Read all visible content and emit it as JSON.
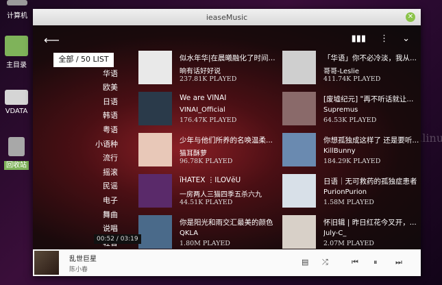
{
  "desktop": {
    "icons": [
      {
        "label": "计算机",
        "color": "#b0b0b0"
      },
      {
        "label": "主目录",
        "color": "#7fb35a"
      },
      {
        "label": "VDATA",
        "color": "#cfcfcf"
      },
      {
        "label": "回收站",
        "color": "#a0a0a0"
      }
    ]
  },
  "window": {
    "title": "ieaseMusic"
  },
  "categories": {
    "active": "全部 / 50 LIST",
    "items": [
      "华语",
      "欧美",
      "日语",
      "韩语",
      "粤语",
      "小语种",
      "流行",
      "摇滚",
      "民谣",
      "电子",
      "舞曲",
      "说唱",
      "轻音"
    ]
  },
  "playlists": [
    {
      "title": "似水年华|在晨曦融化了时间...",
      "creator": "晌有话好好说",
      "played": "237.81K PLAYED",
      "color": "#e9e9e9"
    },
    {
      "title": "「华语」你不必冷淡，我从...",
      "creator": "哥哥-Leslie",
      "played": "411.74K PLAYED",
      "color": "#cfcfcf"
    },
    {
      "title": "We are VINAI",
      "creator": "VINAI_Official",
      "played": "176.47K PLAYED",
      "color": "#2a3a4a"
    },
    {
      "title": "[废墟纪元] \"再不听话就让...",
      "creator": "Supremus",
      "played": "64.53K PLAYED",
      "color": "#8a6a6a"
    },
    {
      "title": "少年与他们所养的名唤温柔...",
      "creator": "猫耳酥萝",
      "played": "96.78K PLAYED",
      "color": "#e8c8b8"
    },
    {
      "title": "你想孤独成这样了 还是要听...",
      "creator": "KillBunny",
      "played": "184.29K PLAYED",
      "color": "#6a8ab0"
    },
    {
      "title": "ĭHATEⅩ ⋮ILOVĕU",
      "creator": "一房两人三猫四季五杀六九",
      "played": "44.51K PLAYED",
      "color": "#5a2a6a"
    },
    {
      "title": "日语｜无可救药的孤独症患者",
      "creator": "PurionPurion",
      "played": "1.58M PLAYED",
      "color": "#d8e0e8"
    },
    {
      "title": "你是阳光和雨交汇最美的颜色",
      "creator": "QKLA",
      "played": "1.80M PLAYED",
      "color": "#4a6a8a"
    },
    {
      "title": "怀旧辑 | 昨日红花今叉开，...",
      "creator": "July-C_",
      "played": "2.07M PLAYED",
      "color": "#d8d0c8"
    }
  ],
  "player": {
    "time": "00:52 / 03:19",
    "song": "乱世巨星",
    "artist": "陈小春"
  },
  "icons": {
    "back": "arrow-left-icon",
    "chart": "bar-chart-icon",
    "more": "more-vert-icon",
    "collapse": "chevron-down-icon"
  },
  "watermark": "www.linuxs.org"
}
